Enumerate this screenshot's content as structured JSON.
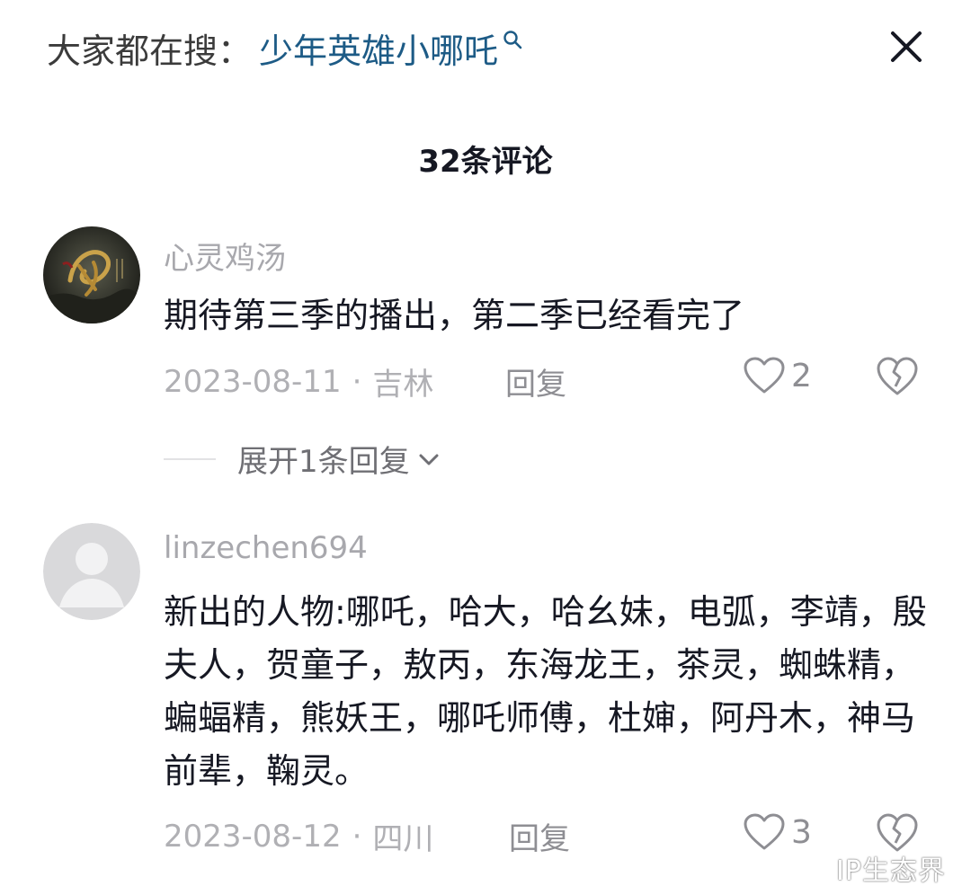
{
  "search": {
    "prefix": "大家都在搜：",
    "term": "少年英雄小哪吒"
  },
  "header": {
    "comment_count_label": "32条评论"
  },
  "comments": [
    {
      "username": "心灵鸡汤",
      "avatar": "ink-calligraphy-avatar",
      "content": "期待第三季的播出，第二季已经看完了",
      "date": "2023-08-11",
      "separator": "·",
      "location": "吉林",
      "reply_label": "回复",
      "likes": "2",
      "expand_label": "展开1条回复"
    },
    {
      "username": "linzechen694",
      "avatar": "default-gray-avatar",
      "content": "新出的人物:哪吒，哈大，哈幺妹，电弧，李靖，殷夫人，贺童子，敖丙，东海龙王，茶灵，蜘蛛精，蝙蝠精，熊妖王，哪吒师傅，杜婶，阿丹木，神马前辈，鞠灵。",
      "date": "2023-08-12",
      "separator": "·",
      "location": "四川",
      "reply_label": "回复",
      "likes": "3"
    }
  ],
  "watermark": "IP生态界",
  "icons": [
    "search-icon",
    "close-icon",
    "heart-icon",
    "broken-heart-icon",
    "chevron-down-icon"
  ],
  "colors": {
    "search_term": "#1d5b86",
    "primary_text": "#161823",
    "secondary_text": "#a8a8ad"
  }
}
